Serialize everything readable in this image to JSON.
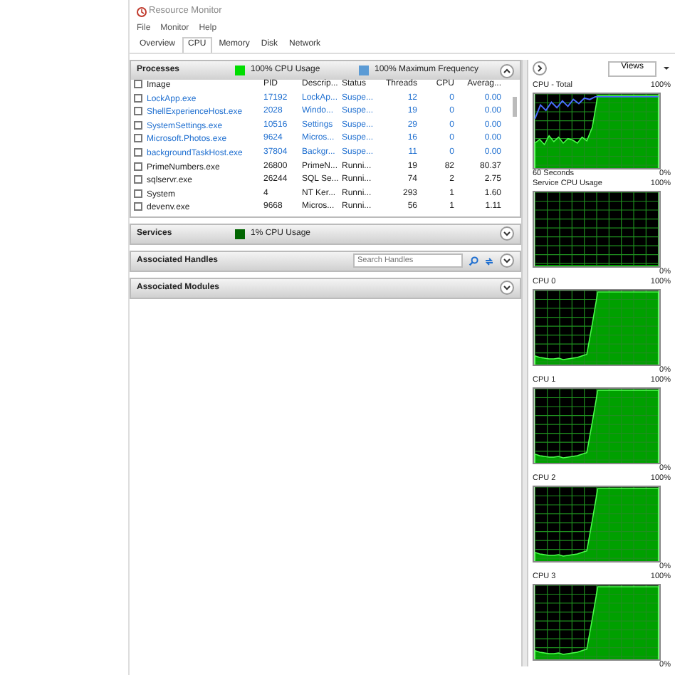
{
  "window": {
    "title": "Resource Monitor"
  },
  "menu": [
    "File",
    "Monitor",
    "Help"
  ],
  "tabs": [
    {
      "label": "Overview",
      "selected": false
    },
    {
      "label": "CPU",
      "selected": true
    },
    {
      "label": "Memory",
      "selected": false
    },
    {
      "label": "Disk",
      "selected": false
    },
    {
      "label": "Network",
      "selected": false
    }
  ],
  "sections": [
    {
      "title": "Processes",
      "expanded": true,
      "indicators": [
        {
          "color": "#00dd00",
          "text": "100% CPU Usage"
        },
        {
          "color": "#5b9bd5",
          "text": "100% Maximum Frequency"
        }
      ],
      "table": {
        "all_checked": false,
        "columns": [
          "Image",
          "PID",
          "Descrip...",
          "Status",
          "Threads",
          "CPU",
          "Averag..."
        ],
        "rows": [
          {
            "checked": false,
            "suspended": true,
            "cells": [
              "LockApp.exe",
              "17192",
              "LockAp...",
              "Suspe...",
              "12",
              "0",
              "0.00"
            ]
          },
          {
            "checked": false,
            "suspended": true,
            "cells": [
              "ShellExperienceHost.exe",
              "2028",
              "Windo...",
              "Suspe...",
              "19",
              "0",
              "0.00"
            ]
          },
          {
            "checked": false,
            "suspended": true,
            "cells": [
              "SystemSettings.exe",
              "10516",
              "Settings",
              "Suspe...",
              "29",
              "0",
              "0.00"
            ]
          },
          {
            "checked": false,
            "suspended": true,
            "cells": [
              "Microsoft.Photos.exe",
              "9624",
              "Micros...",
              "Suspe...",
              "16",
              "0",
              "0.00"
            ]
          },
          {
            "checked": false,
            "suspended": true,
            "cells": [
              "backgroundTaskHost.exe",
              "37804",
              "Backgr...",
              "Suspe...",
              "11",
              "0",
              "0.00"
            ]
          },
          {
            "checked": false,
            "suspended": false,
            "cells": [
              "PrimeNumbers.exe",
              "26800",
              "PrimeN...",
              "Runni...",
              "19",
              "82",
              "80.37"
            ]
          },
          {
            "checked": false,
            "suspended": false,
            "cells": [
              "sqlservr.exe",
              "26244",
              "SQL Se...",
              "Runni...",
              "74",
              "2",
              "2.75"
            ]
          },
          {
            "checked": false,
            "suspended": false,
            "cells": [
              "System",
              "4",
              "NT Ker...",
              "Runni...",
              "293",
              "1",
              "1.60"
            ]
          },
          {
            "checked": false,
            "suspended": false,
            "cells": [
              "devenv.exe",
              "9668",
              "Micros...",
              "Runni...",
              "56",
              "1",
              "1.11"
            ]
          }
        ]
      }
    },
    {
      "title": "Services",
      "expanded": false,
      "indicators": [
        {
          "color": "#006400",
          "text": "1% CPU Usage"
        }
      ]
    },
    {
      "title": "Associated Handles",
      "expanded": false,
      "search": {
        "placeholder": "Search Handles"
      }
    },
    {
      "title": "Associated Modules",
      "expanded": false
    }
  ],
  "side_panel": {
    "views_button": "Views",
    "graphs": [
      {
        "kind": "total",
        "title": "CPU - Total",
        "top_label": "100%",
        "bottom_left": "60 Seconds",
        "bottom_label": "0%"
      },
      {
        "kind": "service",
        "title": "Service CPU Usage",
        "top_label": "100%",
        "bottom_label": "0%"
      },
      {
        "kind": "core",
        "title": "CPU 0",
        "top_label": "100%",
        "bottom_label": "0%"
      },
      {
        "kind": "core",
        "title": "CPU 1",
        "top_label": "100%",
        "bottom_label": "0%"
      },
      {
        "kind": "core",
        "title": "CPU 2",
        "top_label": "100%",
        "bottom_label": "0%"
      },
      {
        "kind": "core",
        "title": "CPU 3",
        "top_label": "100%",
        "bottom_label": "0%"
      }
    ]
  }
}
